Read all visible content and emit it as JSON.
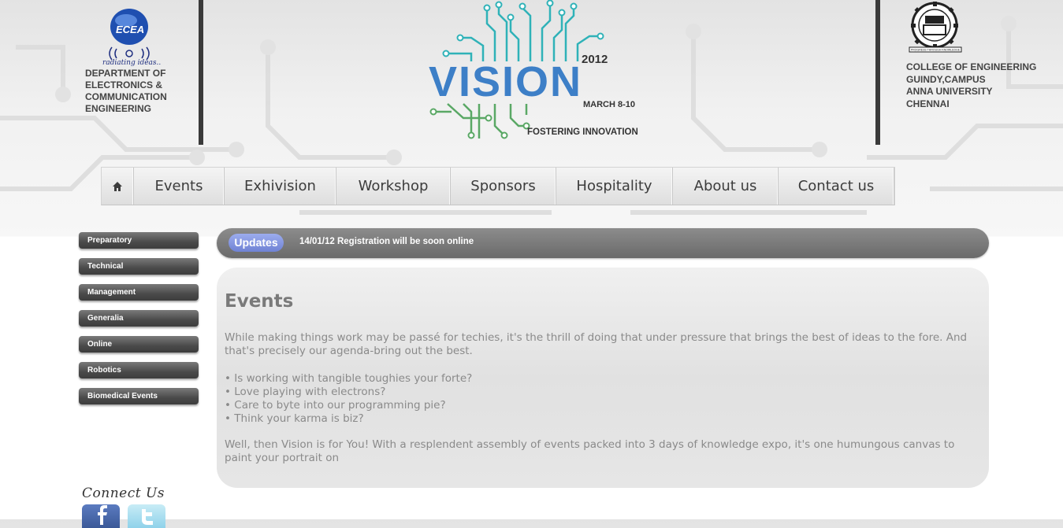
{
  "header": {
    "left_logo_tagline": "radiating ideas..",
    "left_logo_text": "ECEA",
    "department_lines": [
      "DEPARTMENT OF",
      "ELECTRONICS &",
      "COMMUNICATION",
      "ENGINEERING"
    ],
    "event_year": "2012",
    "event_name": "VISION",
    "event_dates": "MARCH 8-10",
    "event_tagline": "FOSTERING INNOVATION",
    "college_seal_caption": "PROGRESS THROUGH KNOWLEDGE",
    "college_lines": [
      "COLLEGE OF ENGINEERING",
      "GUINDY,CAMPUS",
      "ANNA UNIVERSITY",
      "CHENNAI"
    ]
  },
  "nav": {
    "home_icon": "home-icon",
    "items": [
      "Events",
      "Exhivision",
      "Workshop",
      "Sponsors",
      "Hospitality",
      "About us",
      "Contact us"
    ]
  },
  "sidebar": {
    "items": [
      "Preparatory",
      "Technical",
      "Management",
      "Generalia",
      "Online",
      "Robotics",
      "Biomedical Events"
    ]
  },
  "updates": {
    "label": "Updates",
    "date": "14/01/12",
    "message": "Registration will be soon online"
  },
  "content": {
    "title": "Events",
    "intro": "While making things work may be passé for techies, it's the thrill of doing that under pressure that brings the best of ideas to the fore. And that's precisely our agenda-bring out the best.",
    "bullets": [
      "Is working with tangible toughies your forte?",
      "Love playing with electrons?",
      "Care to byte into our programming pie?",
      "Think your karma is biz?"
    ],
    "outro": "Well, then Vision is for You! With a resplendent assembly of events packed into 3 days of knowledge expo, it's one humungous canvas to paint your portrait on"
  },
  "connect": {
    "label": "Connect Us",
    "networks": [
      "facebook-icon",
      "twitter-icon"
    ]
  },
  "colors": {
    "nav_text": "#3c3c3c",
    "sidebar_button": "#4a4a4a",
    "updates_bar": "#7a7a7a",
    "updates_badge": "#7f90dd",
    "vision_blue": "#3d7fc7",
    "vision_green": "#5aa865",
    "content_text": "#8a8a8a"
  }
}
